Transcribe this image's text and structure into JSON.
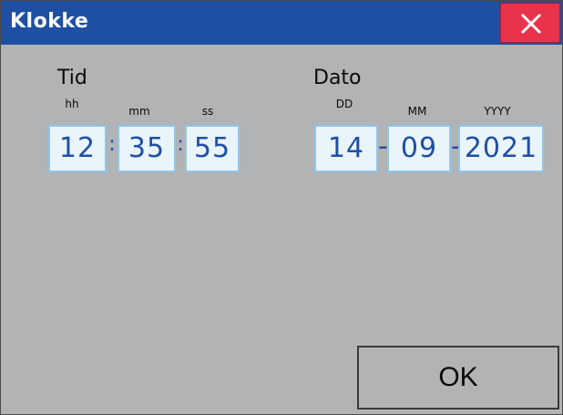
{
  "window": {
    "title": "Klokke",
    "close_icon": "close-x-icon"
  },
  "time": {
    "label": "Tid",
    "sub_labels": {
      "hh": "hh",
      "mm": "mm",
      "ss": "ss"
    },
    "hh": "12",
    "mm": "35",
    "ss": "55",
    "separator": ":"
  },
  "date": {
    "label": "Dato",
    "sub_labels": {
      "dd": "DD",
      "mm": "MM",
      "yyyy": "YYYY"
    },
    "dd": "14",
    "mm": "09",
    "yyyy": "2021",
    "separator": "-"
  },
  "actions": {
    "ok_label": "OK"
  },
  "colors": {
    "titlebar": "#1f4fa3",
    "close": "#e8334a",
    "field_bg": "#e9f4fb",
    "field_border": "#8fc6ea",
    "field_text": "#1f4fa3",
    "background": "#b1b3b4"
  }
}
